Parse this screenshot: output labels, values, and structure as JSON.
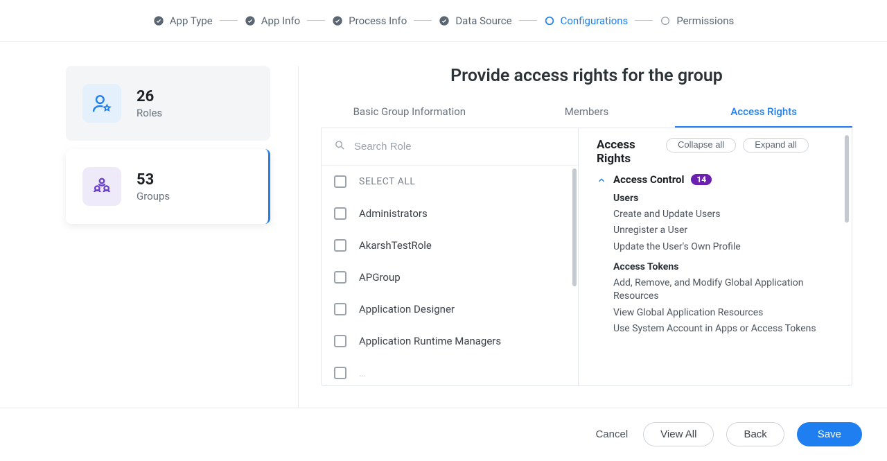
{
  "stepper": {
    "steps": [
      {
        "label": "App Type",
        "state": "done"
      },
      {
        "label": "App Info",
        "state": "done"
      },
      {
        "label": "Process Info",
        "state": "done"
      },
      {
        "label": "Data Source",
        "state": "done"
      },
      {
        "label": "Configurations",
        "state": "current"
      },
      {
        "label": "Permissions",
        "state": "future"
      }
    ]
  },
  "sidebar": {
    "roles": {
      "count": "26",
      "label": "Roles"
    },
    "groups": {
      "count": "53",
      "label": "Groups"
    }
  },
  "page_title": "Provide access rights for the group",
  "tabs": [
    {
      "label": "Basic Group Information",
      "active": false
    },
    {
      "label": "Members",
      "active": false
    },
    {
      "label": "Access Rights",
      "active": true
    }
  ],
  "search": {
    "placeholder": "Search Role"
  },
  "roles_list": {
    "select_all_label": "SELECT ALL",
    "items": [
      "Administrators",
      "AkarshTestRole",
      "APGroup",
      "Application Designer",
      "Application Runtime Managers"
    ]
  },
  "rights": {
    "title": "Access Rights",
    "collapse_label": "Collapse all",
    "expand_label": "Expand all",
    "section_title": "Access Control",
    "section_count": "14",
    "users_heading": "Users",
    "users_items": [
      "Create and Update Users",
      "Unregister a User",
      "Update the User's Own Profile"
    ],
    "tokens_heading": "Access Tokens",
    "tokens_items": [
      "Add, Remove, and Modify Global Application Resources",
      "View Global Application Resources",
      "Use System Account in Apps or Access Tokens"
    ]
  },
  "footer": {
    "cancel": "Cancel",
    "view_all": "View All",
    "back": "Back",
    "save": "Save"
  }
}
